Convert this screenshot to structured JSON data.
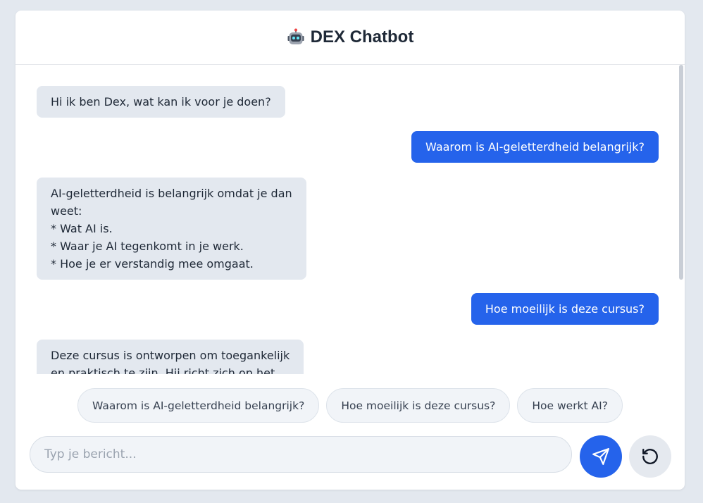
{
  "header": {
    "icon": "robot-icon",
    "title": "DEX Chatbot"
  },
  "messages": [
    {
      "role": "bot",
      "text": "Hi ik ben Dex, wat kan ik voor je doen?"
    },
    {
      "role": "user",
      "text": "Waarom is AI-geletterdheid belangrijk?"
    },
    {
      "role": "bot",
      "text": "AI-geletterdheid is belangrijk omdat je dan\nweet:\n* Wat AI is.\n* Waar je AI tegenkomt in je werk.\n* Hoe je er verstandig mee omgaat."
    },
    {
      "role": "user",
      "text": "Hoe moeilijk is deze cursus?"
    },
    {
      "role": "bot",
      "text": "Deze cursus is ontworpen om toegankelijk\nen praktisch te zijn. Hij richt zich op het"
    }
  ],
  "suggestions": [
    "Waarom is AI-geletterdheid belangrijk?",
    "Hoe moeilijk is deze cursus?",
    "Hoe werkt AI?"
  ],
  "composer": {
    "placeholder": "Typ je bericht...",
    "value": "",
    "send_icon": "send-icon",
    "reset_icon": "reset-icon"
  },
  "colors": {
    "accent": "#2563eb",
    "bot_bubble": "#e3e8ef",
    "background": "#e3e8ef"
  }
}
